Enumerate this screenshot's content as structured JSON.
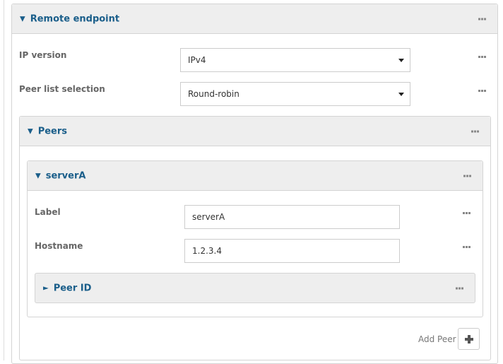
{
  "remote_endpoint": {
    "title": "Remote endpoint",
    "ip_version": {
      "label": "IP version",
      "value": "IPv4"
    },
    "peer_list_selection": {
      "label": "Peer list selection",
      "value": "Round-robin"
    }
  },
  "peers": {
    "title": "Peers",
    "server": {
      "title": "serverA",
      "label_field": {
        "label": "Label",
        "value": "serverA"
      },
      "hostname_field": {
        "label": "Hostname",
        "value": "1.2.3.4"
      },
      "peer_id": {
        "title": "Peer ID"
      }
    },
    "add_peer_label": "Add Peer"
  },
  "icons": {
    "expanded": "triangle-down-icon",
    "collapsed": "triangle-right-icon",
    "menu": "more-icon",
    "add": "plus-icon",
    "dropdown": "caret-down-icon"
  },
  "colors": {
    "title_text": "#1a5e8a",
    "header_bg": "#eeeeee",
    "border": "#d4d4d4",
    "label_text": "#666666"
  }
}
